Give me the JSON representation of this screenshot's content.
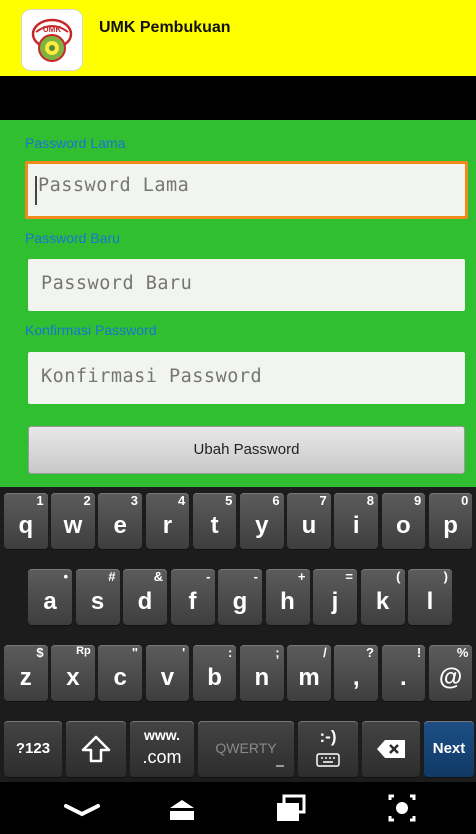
{
  "app": {
    "title": "UMK Pembukuan",
    "colors": {
      "titlebar": "#ffff00",
      "form_bg": "#2fbf30",
      "label": "#1976d2",
      "focus": "#f08a1a"
    }
  },
  "form": {
    "old_password_label": "Password Lama",
    "old_password_placeholder": "Password Lama",
    "new_password_label": "Password Baru",
    "new_password_placeholder": "Password Baru",
    "confirm_password_label": "Konfirmasi Password",
    "confirm_password_placeholder": "Konfirmasi Password",
    "submit_label": "Ubah Password"
  },
  "keyboard": {
    "row1": [
      {
        "main": "q",
        "sup": "1"
      },
      {
        "main": "w",
        "sup": "2"
      },
      {
        "main": "e",
        "sup": "3"
      },
      {
        "main": "r",
        "sup": "4"
      },
      {
        "main": "t",
        "sup": "5"
      },
      {
        "main": "y",
        "sup": "6"
      },
      {
        "main": "u",
        "sup": "7"
      },
      {
        "main": "i",
        "sup": "8"
      },
      {
        "main": "o",
        "sup": "9"
      },
      {
        "main": "p",
        "sup": "0"
      }
    ],
    "row2": [
      {
        "main": "a",
        "sup": "•"
      },
      {
        "main": "s",
        "sup": "#"
      },
      {
        "main": "d",
        "sup": "&"
      },
      {
        "main": "f",
        "sup": "-"
      },
      {
        "main": "g",
        "sup": "-"
      },
      {
        "main": "h",
        "sup": "+"
      },
      {
        "main": "j",
        "sup": "="
      },
      {
        "main": "k",
        "sup": "("
      },
      {
        "main": "l",
        "sup": ")"
      }
    ],
    "row3": [
      {
        "main": "z",
        "sup": "$"
      },
      {
        "main": "x",
        "sup": "Rp"
      },
      {
        "main": "c",
        "sup": "\""
      },
      {
        "main": "v",
        "sup": "'"
      },
      {
        "main": "b",
        "sup": ":"
      },
      {
        "main": "n",
        "sup": ";"
      },
      {
        "main": "m",
        "sup": "/"
      },
      {
        "main": ",",
        "sup": "?"
      },
      {
        "main": ".",
        "sup": "!"
      },
      {
        "main": "@",
        "sup": "%"
      }
    ],
    "sym_label": "?123",
    "www_label": "www.",
    "com_label": ".com",
    "qwerty_label": "QWERTY",
    "emoticon_label": ":-)",
    "next_label": "Next",
    "icons": [
      "shift-icon",
      "keyboard-icon",
      "backspace-icon"
    ]
  },
  "navbar": {
    "icons": [
      "back-icon",
      "home-icon",
      "recents-icon",
      "screenshot-icon"
    ]
  }
}
